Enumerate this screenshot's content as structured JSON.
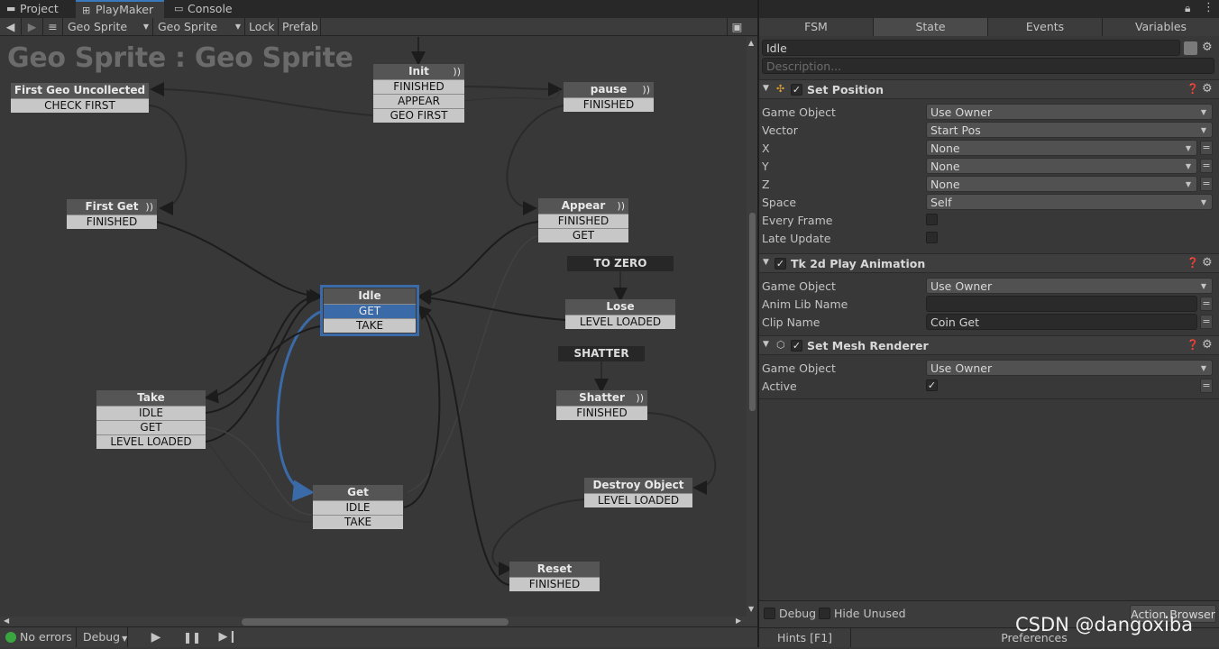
{
  "tabs": {
    "project": "Project",
    "playmaker": "PlayMaker",
    "console": "Console"
  },
  "toolbar": {
    "fsm_owner": "Geo Sprite",
    "fsm_name": "Geo Sprite",
    "lock": "Lock",
    "prefab": "Prefab"
  },
  "canvas": {
    "title": "Geo Sprite : Geo Sprite",
    "states": {
      "init": {
        "name": "Init",
        "transitions": [
          "FINISHED",
          "APPEAR",
          "GEO FIRST"
        ]
      },
      "first_geo_uncollected": {
        "name": "First Geo Uncollected",
        "transitions": [
          "CHECK FIRST"
        ]
      },
      "pause": {
        "name": "pause",
        "transitions": [
          "FINISHED"
        ]
      },
      "first_get": {
        "name": "First Get",
        "transitions": [
          "FINISHED"
        ]
      },
      "appear": {
        "name": "Appear",
        "transitions": [
          "FINISHED",
          "GET"
        ]
      },
      "idle": {
        "name": "Idle",
        "transitions": [
          "GET",
          "TAKE"
        ]
      },
      "lose": {
        "name": "Lose",
        "transitions": [
          "LEVEL LOADED"
        ]
      },
      "shatter": {
        "name": "Shatter",
        "transitions": [
          "FINISHED"
        ]
      },
      "take": {
        "name": "Take",
        "transitions": [
          "IDLE",
          "GET",
          "LEVEL LOADED"
        ]
      },
      "get": {
        "name": "Get",
        "transitions": [
          "IDLE",
          "TAKE"
        ]
      },
      "destroy_object": {
        "name": "Destroy Object",
        "transitions": [
          "LEVEL LOADED"
        ]
      },
      "reset": {
        "name": "Reset",
        "transitions": [
          "FINISHED"
        ]
      }
    },
    "global_events": {
      "to_zero": "TO ZERO",
      "shatter": "SHATTER"
    }
  },
  "bottombar": {
    "status": "No errors",
    "debug": "Debug"
  },
  "inspector": {
    "tabs": [
      "FSM",
      "State",
      "Events",
      "Variables"
    ],
    "state_name": "Idle",
    "description_placeholder": "Description...",
    "actions": [
      {
        "title": "Set Position",
        "fields": [
          {
            "label": "Game Object",
            "value": "Use Owner"
          },
          {
            "label": "Vector",
            "value": "Start Pos"
          },
          {
            "label": "X",
            "value": "None"
          },
          {
            "label": "Y",
            "value": "None"
          },
          {
            "label": "Z",
            "value": "None"
          },
          {
            "label": "Space",
            "value": "Self"
          },
          {
            "label": "Every Frame",
            "value": ""
          },
          {
            "label": "Late Update",
            "value": ""
          }
        ]
      },
      {
        "title": "Tk 2d Play Animation",
        "fields": [
          {
            "label": "Game Object",
            "value": "Use Owner"
          },
          {
            "label": "Anim Lib Name",
            "value": ""
          },
          {
            "label": "Clip Name",
            "value": "Coin Get"
          }
        ]
      },
      {
        "title": "Set Mesh Renderer",
        "fields": [
          {
            "label": "Game Object",
            "value": "Use Owner"
          },
          {
            "label": "Active",
            "value": "✓"
          }
        ]
      }
    ],
    "footer": {
      "debug": "Debug",
      "hide_unused": "Hide Unused",
      "action_browser": "Action Browser",
      "hints": "Hints [F1]",
      "preferences": "Preferences"
    }
  },
  "watermark": "CSDN @dangoxiba",
  "colors": {
    "accent": "#3b6aa8",
    "background": "#383838",
    "node_header": "#555555",
    "transition": "#c7c7c7"
  }
}
